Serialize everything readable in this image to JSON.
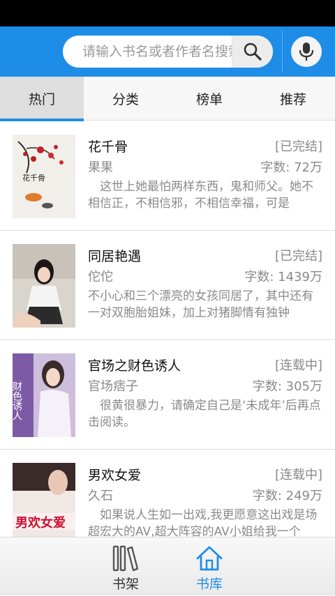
{
  "search": {
    "placeholder": "请输入书名或者作者名搜索"
  },
  "tabs": [
    {
      "label": "热门",
      "active": true
    },
    {
      "label": "分类",
      "active": false
    },
    {
      "label": "榜单",
      "active": false
    },
    {
      "label": "推荐",
      "active": false
    }
  ],
  "books": [
    {
      "title": "花千骨",
      "status": "[已完结]",
      "author": "果果",
      "words": "字数: 72万",
      "desc": "　这世上她最怕两样东西，鬼和师父。她不相信正，不相信邪，不相信幸福，可是"
    },
    {
      "title": "同居艳遇",
      "status": "[已完结]",
      "author": "佗佗",
      "words": "字数: 1439万",
      "desc": "不小心和三个漂亮的女孩同居了，其中还有一对双胞胎姐妹，加上对猪脚情有独钟"
    },
    {
      "title": "官场之财色诱人",
      "status": "[连载中]",
      "author": "官场痞子",
      "words": "字数: 305万",
      "desc": "　很黄很暴力，请确定自己是‘未成年’后再点击阅读。"
    },
    {
      "title": "男欢女爱",
      "status": "[连载中]",
      "author": "久石",
      "words": "字数: 249万",
      "desc": "　如果说人生如一出戏,我更愿意这出戏是场超宏大的AV,超大阵容的AV小姐给我一个"
    }
  ],
  "covers": [
    {
      "text": "花千骨",
      "icon": "painting-cover"
    },
    {
      "text": "",
      "icon": "photo-cover"
    },
    {
      "text": "财色诱人",
      "icon": "poster-cover"
    },
    {
      "text": "男欢女爱",
      "icon": "poster-cover"
    }
  ],
  "bottom_nav": [
    {
      "label": "书架",
      "icon": "bookshelf-icon",
      "active": false
    },
    {
      "label": "书库",
      "icon": "home-icon",
      "active": true
    }
  ],
  "colors": {
    "accent": "#1e8de8",
    "muted": "#8a8a8a"
  }
}
